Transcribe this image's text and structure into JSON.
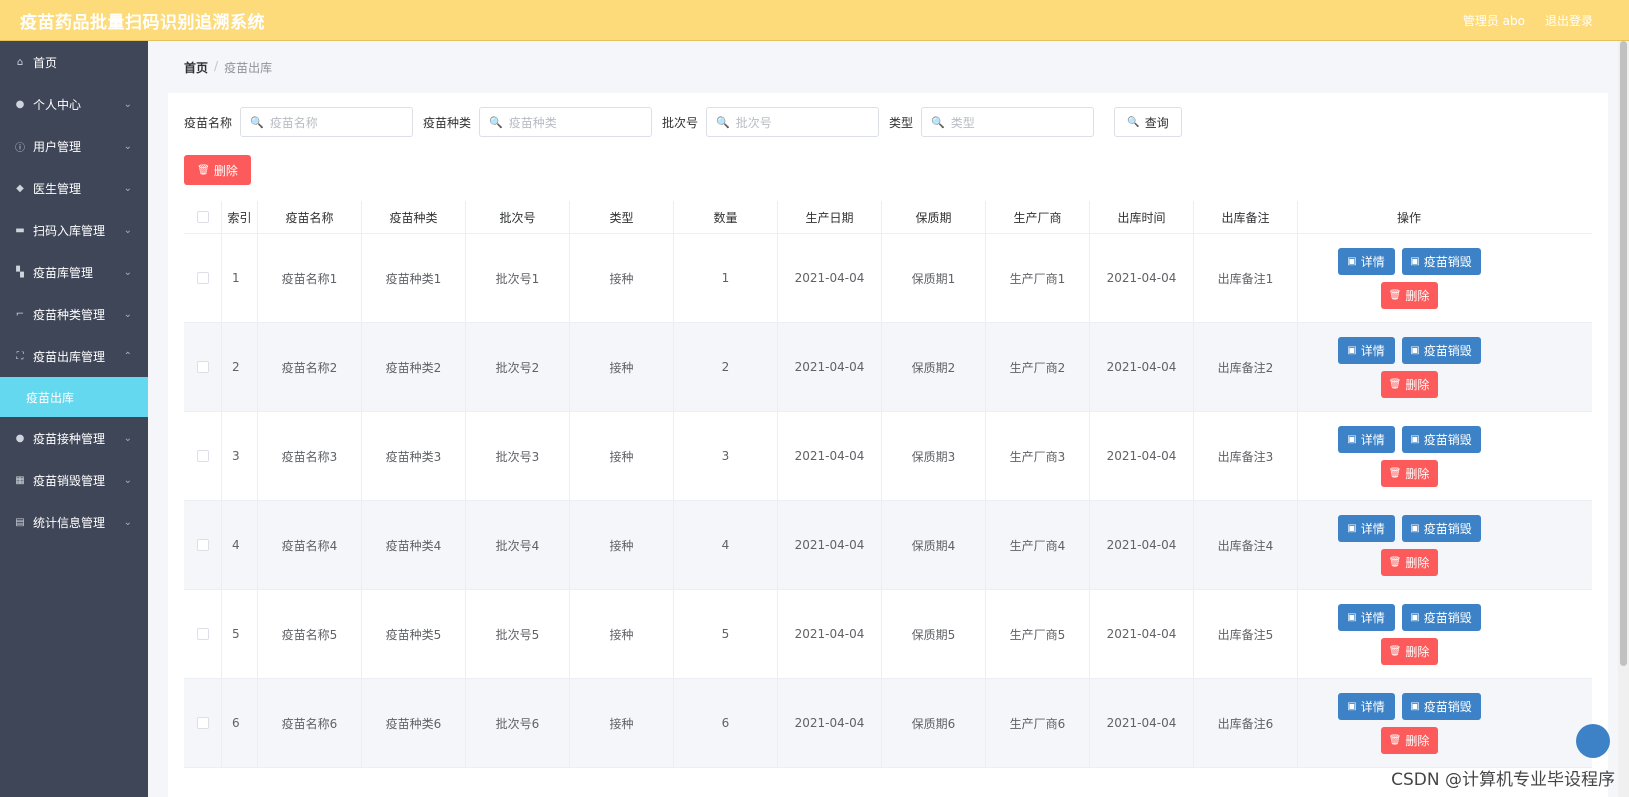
{
  "app": {
    "title": "疫苗药品批量扫码识别追溯系统",
    "user": "管理员 abo",
    "logout": "退出登录"
  },
  "sidebar": {
    "items": [
      {
        "label": "首页",
        "icon": "home-icon",
        "glyph": "⌂",
        "chevron": ""
      },
      {
        "label": "个人中心",
        "icon": "user-icon",
        "glyph": "●",
        "chevron": "⌄"
      },
      {
        "label": "用户管理",
        "icon": "info-icon",
        "glyph": "ⓘ",
        "chevron": "⌄"
      },
      {
        "label": "医生管理",
        "icon": "shield-icon",
        "glyph": "◆",
        "chevron": "⌄"
      },
      {
        "label": "扫码入库管理",
        "icon": "chat-icon",
        "glyph": "▬",
        "chevron": "⌄"
      },
      {
        "label": "疫苗库管理",
        "icon": "flag-icon",
        "glyph": "▚",
        "chevron": "⌄"
      },
      {
        "label": "疫苗种类管理",
        "icon": "crop-icon",
        "glyph": "⌐",
        "chevron": "⌄"
      },
      {
        "label": "疫苗出库管理",
        "icon": "fullscreen-icon",
        "glyph": "⛶",
        "chevron": "⌃"
      },
      {
        "label": "疫苗出库",
        "icon": "",
        "glyph": "",
        "chevron": ""
      },
      {
        "label": "疫苗接种管理",
        "icon": "user-icon",
        "glyph": "●",
        "chevron": "⌄"
      },
      {
        "label": "疫苗销毁管理",
        "icon": "grid-icon",
        "glyph": "▦",
        "chevron": "⌄"
      },
      {
        "label": "统计信息管理",
        "icon": "document-icon",
        "glyph": "▤",
        "chevron": "⌄"
      }
    ]
  },
  "breadcrumb": {
    "home": "首页",
    "sep": "/",
    "current": "疫苗出库"
  },
  "search": {
    "fields": [
      {
        "label": "疫苗名称",
        "placeholder": "疫苗名称"
      },
      {
        "label": "疫苗种类",
        "placeholder": "疫苗种类"
      },
      {
        "label": "批次号",
        "placeholder": "批次号"
      },
      {
        "label": "类型",
        "placeholder": "类型"
      }
    ],
    "query_label": "查询",
    "search_icon": "🔍"
  },
  "toolbar": {
    "delete_label": "删除"
  },
  "table": {
    "headers": [
      "索引",
      "疫苗名称",
      "疫苗种类",
      "批次号",
      "类型",
      "数量",
      "生产日期",
      "保质期",
      "生产厂商",
      "出库时间",
      "出库备注",
      "操作"
    ],
    "rows": [
      [
        "1",
        "疫苗名称1",
        "疫苗种类1",
        "批次号1",
        "接种",
        "1",
        "2021-04-04",
        "保质期1",
        "生产厂商1",
        "2021-04-04",
        "出库备注1"
      ],
      [
        "2",
        "疫苗名称2",
        "疫苗种类2",
        "批次号2",
        "接种",
        "2",
        "2021-04-04",
        "保质期2",
        "生产厂商2",
        "2021-04-04",
        "出库备注2"
      ],
      [
        "3",
        "疫苗名称3",
        "疫苗种类3",
        "批次号3",
        "接种",
        "3",
        "2021-04-04",
        "保质期3",
        "生产厂商3",
        "2021-04-04",
        "出库备注3"
      ],
      [
        "4",
        "疫苗名称4",
        "疫苗种类4",
        "批次号4",
        "接种",
        "4",
        "2021-04-04",
        "保质期4",
        "生产厂商4",
        "2021-04-04",
        "出库备注4"
      ],
      [
        "5",
        "疫苗名称5",
        "疫苗种类5",
        "批次号5",
        "接种",
        "5",
        "2021-04-04",
        "保质期5",
        "生产厂商5",
        "2021-04-04",
        "出库备注5"
      ],
      [
        "6",
        "疫苗名称6",
        "疫苗种类6",
        "批次号6",
        "接种",
        "6",
        "2021-04-04",
        "保质期6",
        "生产厂商6",
        "2021-04-04",
        "出库备注6"
      ]
    ],
    "actions": {
      "detail": "详情",
      "destroy": "疫苗销毁",
      "delete": "删除"
    }
  },
  "watermark": "CSDN @计算机专业毕设程序",
  "colors": {
    "topbar": "#fddb7a",
    "sidebar": "#3f4657",
    "active_submenu": "#64d8ef",
    "primary": "#3d82c6",
    "danger": "#fd5b5b"
  }
}
